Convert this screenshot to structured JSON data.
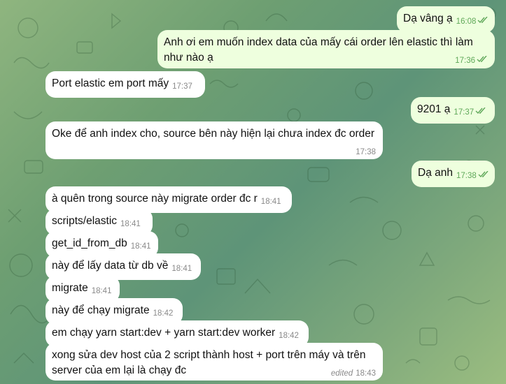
{
  "colors": {
    "incoming_bubble": "#ffffff",
    "outgoing_bubble": "#eeffde",
    "outgoing_time": "#5fa859",
    "incoming_time": "#8a8a8a"
  },
  "messages": [
    {
      "text": "Dạ vâng ạ",
      "time": "16:08",
      "direction": "out",
      "read": true
    },
    {
      "text": "Anh ơi em muốn index data của mấy cái order lên elastic thì làm như nào ạ",
      "time": "17:36",
      "direction": "out",
      "read": true
    },
    {
      "text": "Port elastic em port mấy",
      "time": "17:37",
      "direction": "in"
    },
    {
      "text": "9201 ạ",
      "time": "17:37",
      "direction": "out",
      "read": true
    },
    {
      "text": "Oke để anh index cho, source bên này hiện lại chưa index đc order",
      "time": "17:38",
      "direction": "in"
    },
    {
      "text": "Dạ anh",
      "time": "17:38",
      "direction": "out",
      "read": true
    },
    {
      "text": "à quên trong source này migrate order đc r",
      "time": "18:41",
      "direction": "in"
    },
    {
      "text": "scripts/elastic",
      "time": "18:41",
      "direction": "in"
    },
    {
      "text": "get_id_from_db",
      "time": "18:41",
      "direction": "in"
    },
    {
      "text": "này để lấy data từ db về",
      "time": "18:41",
      "direction": "in"
    },
    {
      "text": "migrate",
      "time": "18:41",
      "direction": "in"
    },
    {
      "text": "này để chạy migrate",
      "time": "18:42",
      "direction": "in"
    },
    {
      "text": "em chạy yarn start:dev + yarn start:dev worker",
      "time": "18:42",
      "direction": "in"
    },
    {
      "text": "xong sửa dev host của 2 script thành host + port trên máy và trên server của em lại là chạy đc",
      "time": "18:43",
      "direction": "in",
      "edited": "edited"
    }
  ]
}
